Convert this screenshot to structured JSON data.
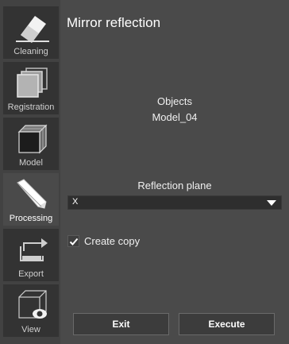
{
  "sidebar": {
    "items": [
      {
        "label": "Cleaning",
        "icon": "eraser-icon"
      },
      {
        "label": "Registration",
        "icon": "layers-icon"
      },
      {
        "label": "Model",
        "icon": "cube-icon"
      },
      {
        "label": "Processing",
        "icon": "pencil-icon",
        "active": true
      },
      {
        "label": "Export",
        "icon": "export-arrow-icon"
      },
      {
        "label": "View",
        "icon": "eye-cube-icon"
      }
    ]
  },
  "panel": {
    "title": "Mirror reflection",
    "objects_label": "Objects",
    "objects_value": "Model_04",
    "plane_label": "Reflection plane",
    "plane_value": "X",
    "create_copy_label": "Create copy",
    "create_copy_checked": true
  },
  "buttons": {
    "exit": "Exit",
    "execute": "Execute"
  },
  "colors": {
    "background": "#4a4a4a",
    "sidebar_tile": "#333333",
    "select_bg": "#2e2e2e"
  }
}
